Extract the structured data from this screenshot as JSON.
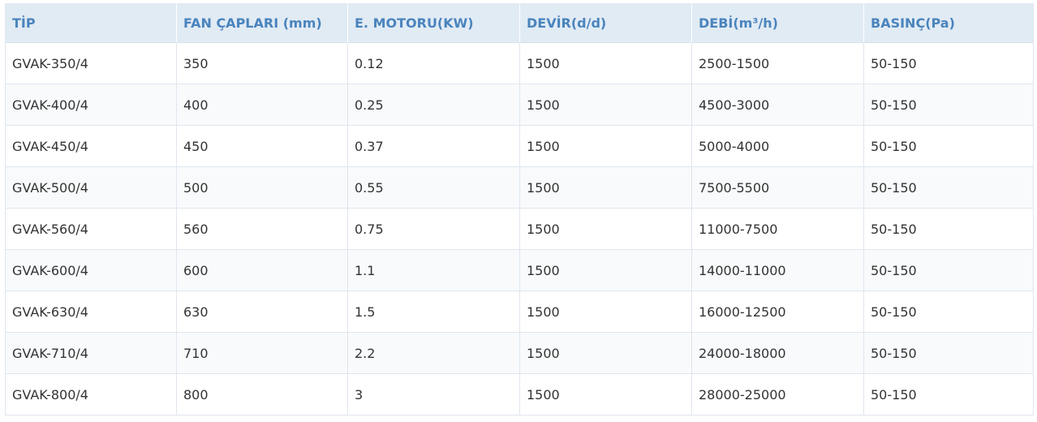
{
  "table": {
    "headers": [
      "TİP",
      "FAN ÇAPLARI (mm)",
      "E. MOTORU(KW)",
      "DEVİR(d/d)",
      "DEBİ(m³/h)",
      "BASINÇ(Pa)"
    ],
    "rows": [
      [
        "GVAK-350/4",
        "350",
        "0.12",
        "1500",
        "2500-1500",
        "50-150"
      ],
      [
        "GVAK-400/4",
        "400",
        "0.25",
        "1500",
        "4500-3000",
        "50-150"
      ],
      [
        "GVAK-450/4",
        "450",
        "0.37",
        "1500",
        "5000-4000",
        "50-150"
      ],
      [
        "GVAK-500/4",
        "500",
        "0.55",
        "1500",
        "7500-5500",
        "50-150"
      ],
      [
        "GVAK-560/4",
        "560",
        "0.75",
        "1500",
        "11000-7500",
        "50-150"
      ],
      [
        "GVAK-600/4",
        "600",
        "1.1",
        "1500",
        "14000-11000",
        "50-150"
      ],
      [
        "GVAK-630/4",
        "630",
        "1.5",
        "1500",
        "16000-12500",
        "50-150"
      ],
      [
        "GVAK-710/4",
        "710",
        "2.2",
        "1500",
        "24000-18000",
        "50-150"
      ],
      [
        "GVAK-800/4",
        "800",
        "3",
        "1500",
        "28000-25000",
        "50-150"
      ]
    ]
  },
  "colors": {
    "header_background": "#e1ebf4",
    "header_text": "#4a84bd",
    "cell_text": "#333333",
    "grid_line": "#dfe6ee"
  }
}
